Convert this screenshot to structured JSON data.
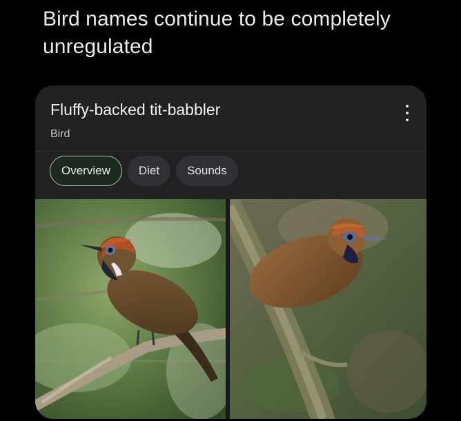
{
  "caption": "Bird names continue to be completely unregulated",
  "card": {
    "title": "Fluffy-backed tit-babbler",
    "subtitle": "Bird",
    "tabs": [
      {
        "label": "Overview",
        "active": true
      },
      {
        "label": "Diet",
        "active": false
      },
      {
        "label": "Sounds",
        "active": false
      }
    ]
  },
  "icons": {
    "more": "more-vert-icon"
  },
  "colors": {
    "card_bg": "#212124",
    "chip_bg": "#303134",
    "active_chip_border": "#a8c7a7"
  }
}
